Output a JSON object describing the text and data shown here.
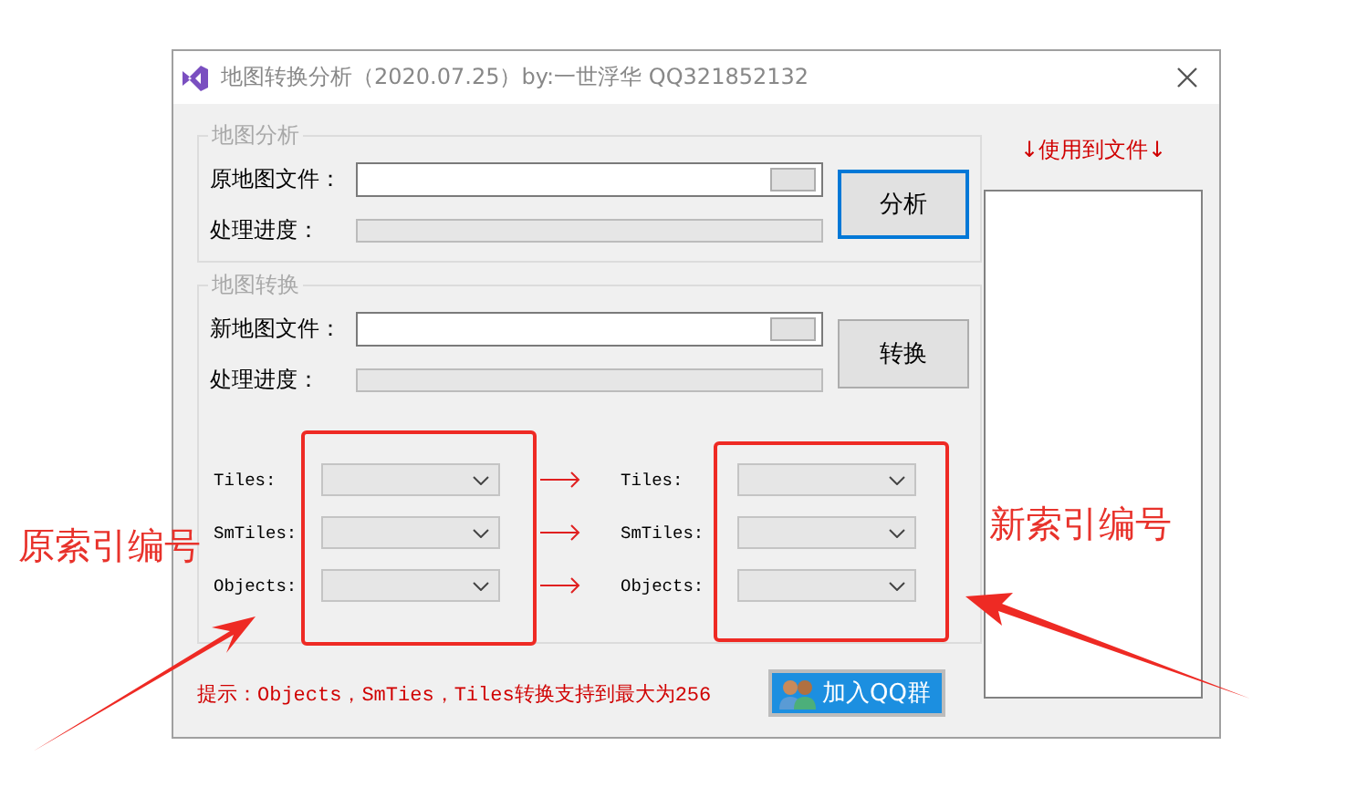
{
  "window": {
    "title": "地图转换分析（2020.07.25）by:一世浮华 QQ321852132"
  },
  "analysis": {
    "legend": "地图分析",
    "file_label": "原地图文件：",
    "progress_label": "处理进度：",
    "progress": {
      "level": 0
    },
    "button": {
      "label": "分析",
      "default": true
    }
  },
  "convert": {
    "legend": "地图转换",
    "file_label": "新地图文件：",
    "progress_label": "处理进度：",
    "progress": {
      "level": 0
    },
    "button": {
      "label": "转换",
      "default": false
    },
    "mappings": [
      {
        "source_label": "Tiles:",
        "source_disabled": true,
        "target_label": "Tiles:",
        "target_disabled": true
      },
      {
        "source_label": "SmTiles:",
        "source_disabled": true,
        "target_label": "SmTiles:",
        "target_disabled": true
      },
      {
        "source_label": "Objects:",
        "source_disabled": true,
        "target_label": "Objects:",
        "target_disabled": true
      }
    ]
  },
  "usage_label": "↓使用到文件↓",
  "hint": "提示：Objects，SmTies，Tiles转换支持到最大为256",
  "qq_button": "加入QQ群",
  "annotations": [
    {
      "text": "原索引编号"
    },
    {
      "text": "新索引编号"
    }
  ]
}
